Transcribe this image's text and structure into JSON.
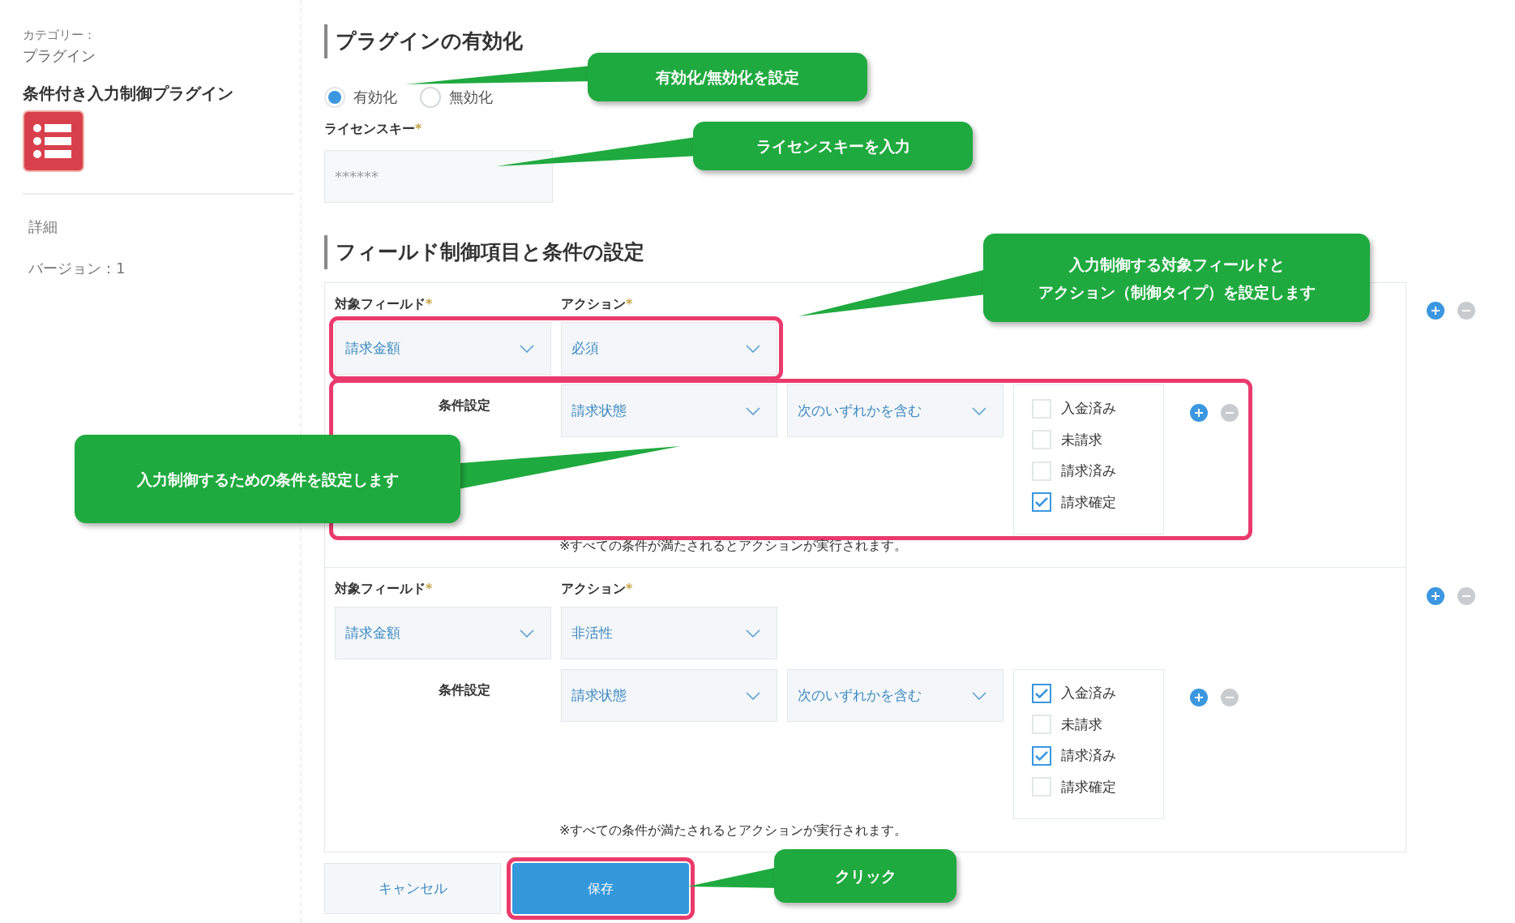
{
  "sidebar": {
    "category_label": "カテゴリー：",
    "category": "プラグイン",
    "plugin_name": "条件付き入力制御プラグイン",
    "links": [
      "詳細",
      "バージョン：1"
    ]
  },
  "activation": {
    "heading": "プラグインの有効化",
    "options": [
      {
        "label": "有効化",
        "selected": true
      },
      {
        "label": "無効化",
        "selected": false
      }
    ]
  },
  "license": {
    "label": "ライセンスキー",
    "required_mark": "*",
    "value": "******"
  },
  "field_settings": {
    "heading": "フィールド制御項目と条件の設定",
    "blocks": [
      {
        "field_label": "対象フィールド",
        "field_required_mark": "*",
        "action_label": "アクション",
        "action_required_mark": "*",
        "field_value": "請求金額",
        "action_value": "必須",
        "highlighted": true,
        "conditions": [
          {
            "label": "条件設定",
            "field_value": "請求状態",
            "operator_value": "次のいずれかを含む",
            "highlighted": true,
            "options": [
              {
                "label": "入金済み",
                "checked": false
              },
              {
                "label": "未請求",
                "checked": false
              },
              {
                "label": "請求済み",
                "checked": false
              },
              {
                "label": "請求確定",
                "checked": true
              }
            ]
          }
        ],
        "note": "※すべての条件が満たされるとアクションが実行されます。"
      },
      {
        "field_label": "対象フィールド",
        "field_required_mark": "*",
        "action_label": "アクション",
        "action_required_mark": "*",
        "field_value": "請求金額",
        "action_value": "非活性",
        "highlighted": false,
        "conditions": [
          {
            "label": "条件設定",
            "field_value": "請求状態",
            "operator_value": "次のいずれかを含む",
            "highlighted": false,
            "options": [
              {
                "label": "入金済み",
                "checked": true
              },
              {
                "label": "未請求",
                "checked": false
              },
              {
                "label": "請求済み",
                "checked": true
              },
              {
                "label": "請求確定",
                "checked": false
              }
            ]
          }
        ],
        "note": "※すべての条件が満たされるとアクションが実行されます。"
      }
    ]
  },
  "buttons": {
    "cancel": "キャンセル",
    "save": "保存",
    "save_highlighted": true
  },
  "annotations": [
    [
      "有効化/無効化を設定"
    ],
    [
      "ライセンスキーを入力"
    ],
    [
      "入力制御する対象フィールドと",
      "アクション（制御タイプ）を設定します"
    ],
    [
      "入力制御するための条件を設定します"
    ],
    [
      "クリック"
    ]
  ]
}
